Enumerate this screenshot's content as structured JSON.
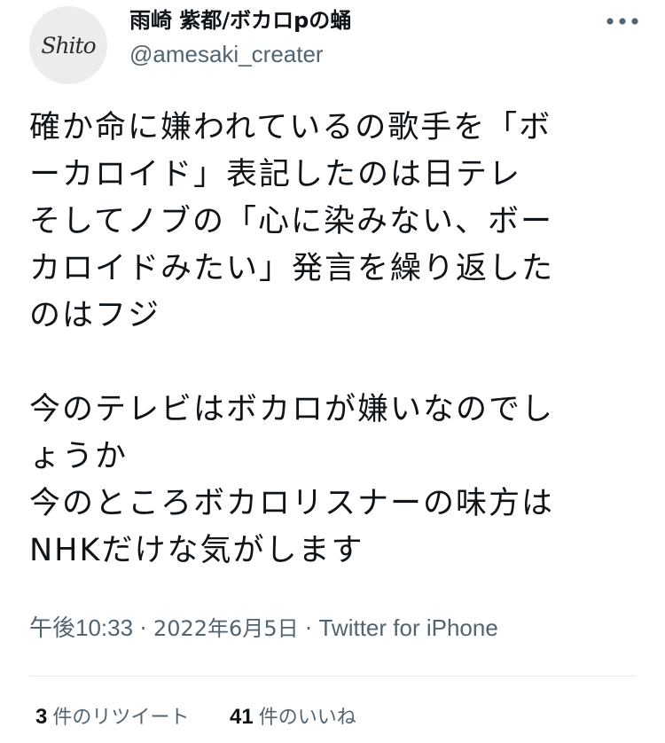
{
  "author": {
    "avatar_text": "Shito",
    "display_name": "雨崎 紫都/ボカロpの蛹",
    "handle": "@amesaki_creater"
  },
  "icons": {
    "more": "more-horizontal-icon"
  },
  "tweet": {
    "lines": [
      "確か命に嫌われているの歌手を「ボ",
      "ーカロイド」表記したのは日テレ",
      "そしてノブの「心に染みない、ボー",
      "カロイドみたい」発言を繰り返した",
      "のはフジ",
      "",
      "今のテレビはボカロが嫌いなのでし",
      "ょうか",
      "今のところボカロリスナーの味方は",
      "NHKだけな気がします"
    ]
  },
  "meta": {
    "time": "午後10:33",
    "separator": " · ",
    "date": "2022年6月5日",
    "source": "Twitter for iPhone"
  },
  "stats": {
    "retweets_count": "3",
    "retweets_label": "件のリツイート",
    "likes_count": "41",
    "likes_label": "件のいいね"
  },
  "colors": {
    "text_primary": "#0f1419",
    "text_secondary": "#536471",
    "divider": "#e6ecf0",
    "avatar_bg": "#ececec"
  }
}
